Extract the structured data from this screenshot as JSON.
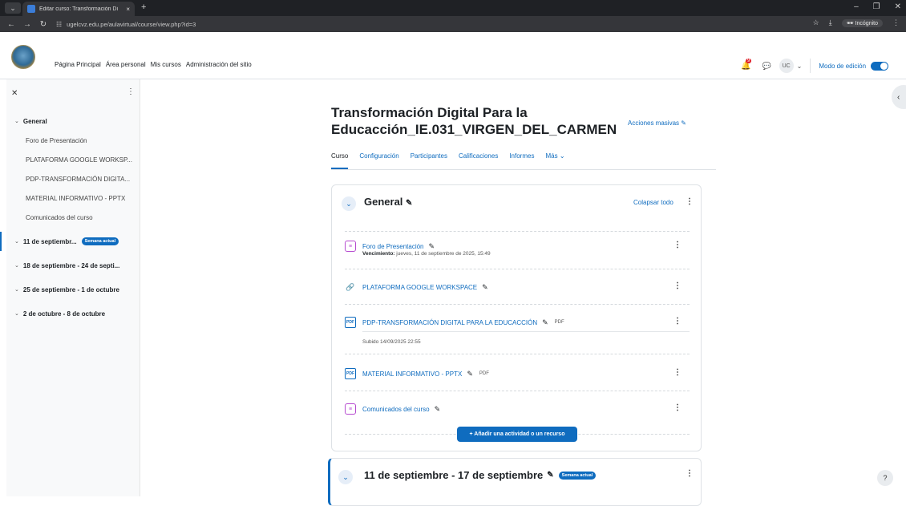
{
  "browser": {
    "tab_title": "Editar curso: Transformación Di",
    "tab_close": "×",
    "new_tab": "+",
    "url": "ugelcvz.edu.pe/aulavirtual/course/view.php?id=3",
    "incognito_label": "Incógnito"
  },
  "site_nav": {
    "items": [
      "Página Principal",
      "Área personal",
      "Mis cursos",
      "Administración del sitio"
    ],
    "notification_count": "9",
    "user_initials": "UC",
    "edit_mode_label": "Modo de edición"
  },
  "drawer": {
    "sections": [
      {
        "label": "General",
        "items": [
          "Foro de Presentación",
          "PLATAFORMA GOOGLE WORKSP...",
          "PDP-TRANSFORMACIÓN DIGITA...",
          "MATERIAL INFORMATIVO - PPTX",
          "Comunicados del curso"
        ]
      },
      {
        "label": "11 de septiembr...",
        "badge": "Semana actual"
      },
      {
        "label": "18 de septiembre - 24 de septi..."
      },
      {
        "label": "25 de septiembre - 1 de octubre"
      },
      {
        "label": "2 de octubre - 8 de octubre"
      }
    ]
  },
  "course": {
    "title": "Transformación Digital Para la Educacción_IE.031_VIRGEN_DEL_CARMEN",
    "bulk_actions": "Acciones masivas",
    "tabs": [
      "Curso",
      "Configuración",
      "Participantes",
      "Calificaciones",
      "Informes",
      "Más"
    ]
  },
  "general_section": {
    "title": "General",
    "collapse_all": "Colapsar todo",
    "activities": [
      {
        "name": "Foro de Presentación",
        "icon": "forum-icon",
        "meta_label": "Vencimiento:",
        "meta_value": "jueves, 11 de septiembre de 2025, 15:49"
      },
      {
        "name": "PLATAFORMA GOOGLE WORKSPACE",
        "icon": "link-icon"
      },
      {
        "name": "PDP-TRANSFORMACIÓN DIGITAL PARA LA EDUCACCIÓN",
        "icon": "pdf-icon",
        "type": "PDF",
        "meta_value": "Subido 14/09/2025 22:55"
      },
      {
        "name": "MATERIAL INFORMATIVO - PPTX",
        "icon": "pdf-icon",
        "type": "PDF"
      },
      {
        "name": "Comunicados del curso",
        "icon": "forum-icon"
      }
    ],
    "add_button": "+ Añadir una actividad o un recurso"
  },
  "week_section": {
    "title": "11 de septiembre - 17 de septiembre",
    "badge": "Semana actual"
  },
  "help_label": "?",
  "colors": {
    "primary": "#0f6cbf",
    "forum": "#b64bd0",
    "badge_red": "#e0212a"
  }
}
